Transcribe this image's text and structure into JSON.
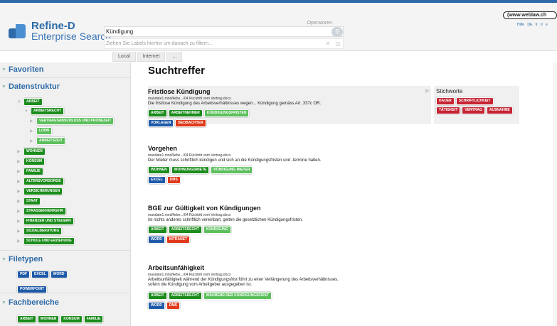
{
  "header": {
    "logo_title": "Refine-D",
    "logo_sub": "Enterprise Search",
    "operators_label": "Operatoren",
    "search_value": "Kündigung",
    "labels_placeholder": "Ziehen Sie Labels hierhin um danach zu filtern...",
    "brand": "(www.weblaw.ch",
    "lang": [
      "Hilfe",
      "DE",
      "fr",
      "it",
      "e"
    ]
  },
  "scope_tabs": [
    "Local",
    "Internet",
    "..."
  ],
  "sidebar": {
    "favoriten": "Favoriten",
    "datenstruktur": "Datenstruktur",
    "tree": {
      "arbeit": "ARBEIT",
      "arbeitsrecht": "ARBEITSRECHT",
      "vertragsabschluss": "VERTRAGSABSCHLUSS UND PROBEZEIT",
      "lohn": "LOHN",
      "arbeitszeit": "ARBEITSZEIT",
      "wohnen": "WOHNEN",
      "konsum": "KONSUM",
      "familie": "FAMILIE",
      "altersvorsorge": "ALTERSVORSORGE",
      "versicherungen": "VERSICHERUNGEN",
      "staat": "STAAT",
      "strassenverkehr": "STRASSENVERKEHR",
      "finanzen": "FINANZEN UND STEUERN",
      "sozialberatung": "SOZIALBERATUNG",
      "schule": "SCHULE UND ERZIEHUNG"
    },
    "filetypen": "Filetypen",
    "filetypes": [
      "PDF",
      "EXCEL",
      "WORD",
      "POWERPOINT"
    ],
    "fachbereiche": "Fachbereiche",
    "fach": [
      "ARBEIT",
      "WOHNEN",
      "KONSUM",
      "FAMILIE"
    ]
  },
  "main": {
    "title": "Suchtreffer",
    "results": [
      {
        "title": "Fristlose Kündigung",
        "path": "mandate1.mnd/Arbe.../04 Rücktritt vom Vertrag.docx",
        "desc": "Die fristlose Kündigung des Arbeitsverhältnisses wegen... Kündigung gemäss Art. 337c OR.",
        "desc2": "",
        "chips1": [
          "ARBEIT",
          "ARBEITNEHMER",
          "KÜNDIGUNGSFRISTEN"
        ],
        "chips2": [
          "VORLAGEN",
          "BEOBACHTER"
        ]
      },
      {
        "title": "Vorgehen",
        "path": "mandate1.mnd/Arbe.../04 Rücktritt vom Vertrag.docx",
        "desc": "Der Mieter muss schriftlich kündigen und sich an die Kündigungsfristen und -termine halten.",
        "desc2": "",
        "chips1": [
          "WOHNEN",
          "WOHNUNGSMIETE",
          "KÜNDIGUNG MIETER"
        ],
        "chips2": [
          "EXCEL",
          "DMS"
        ]
      },
      {
        "title": "BGE zur Gültigkeit von Kündigungen",
        "path": "mandate1.mnd/Arbe.../04 Rücktritt vom Vertrag.docx",
        "desc": "Ist nichts anderes schriftlich vereinbart, gelten die gesetzlichen Kündigungsfristen.",
        "desc2": "",
        "chips1": [
          "ARBEIT",
          "ARBEITSRECHT",
          "KÜNDIGUNG"
        ],
        "chips2": [
          "WORD",
          "INTRANET"
        ]
      },
      {
        "title": "Arbeitsunfähigkeit",
        "path": "mandate1.mnd/Arbe.../04 Rücktritt vom Vertrag.docx",
        "desc": "Arbeitsunfähigkeit während der Kündigungsfrist führt zu einer Verlängerung des Arbeitsverhältnisses,",
        "desc2": "sofern die Kündigung vom Arbeitgeber ausgegeben ist.",
        "chips1": [
          "ARBEIT",
          "ARBEITSRECHT",
          "WÄHREND DER KÜNDIGUNGSFRIST"
        ],
        "chips2": [
          "WORD",
          "DMS"
        ]
      }
    ],
    "stichworte": {
      "title": "Stichworte",
      "chips": [
        "DAUER",
        "SCHRIFTLICHKEIT",
        "TÄTIGKEIT",
        "VERTRAG",
        "AUSNAHME"
      ]
    }
  },
  "colors": {
    "accent": "#2e6aa8",
    "green_dark": "#1c8c1c",
    "green_light": "#5cbf5c",
    "blue": "#1e5aa8",
    "red": "#e0391a",
    "crimson": "#c62433"
  }
}
